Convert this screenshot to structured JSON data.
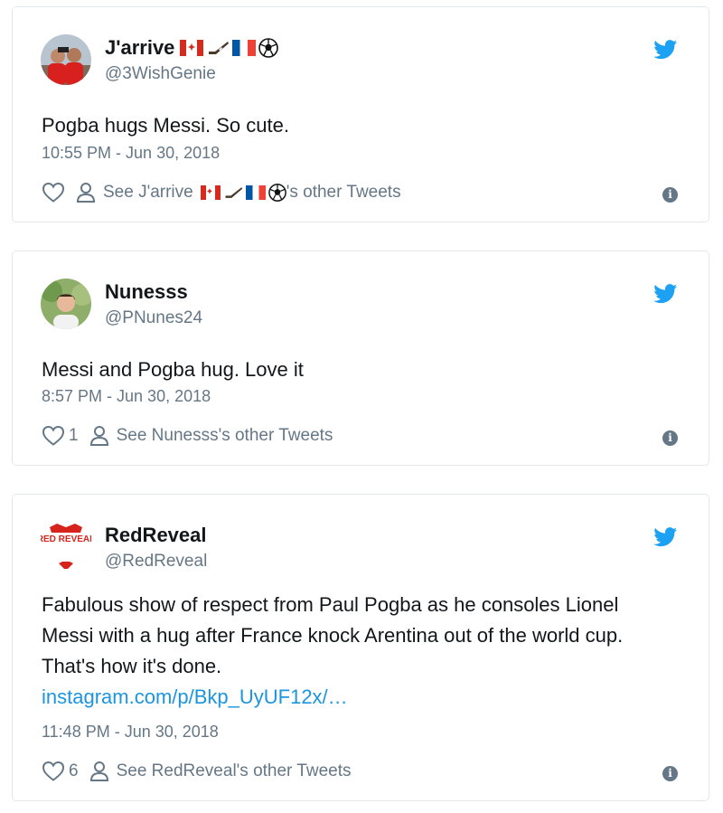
{
  "tweets": [
    {
      "display_name": "J'arrive",
      "name_emojis": [
        "flag-canada",
        "hockey-stick",
        "flag-france",
        "soccer-ball"
      ],
      "handle": "@3WishGenie",
      "text": "Pogba hugs Messi. So cute.",
      "timestamp": "10:55 PM - Jun 30, 2018",
      "likes": "",
      "other_tweets_prefix": "See J'arrive",
      "other_tweets_suffix": "'s other Tweets"
    },
    {
      "display_name": "Nunesss",
      "handle": "@PNunes24",
      "text": "Messi and Pogba hug. Love it",
      "timestamp": "8:57 PM - Jun 30, 2018",
      "likes": "1",
      "other_tweets": "See Nunesss's other Tweets"
    },
    {
      "display_name": "RedReveal",
      "handle": "@RedReveal",
      "avatar_text": "RED REVEAL",
      "text": "Fabulous show of respect from Paul Pogba as he consoles Lionel Messi with a hug after France knock Arentina out of the world cup. That's how it's done.",
      "link": "instagram.com/p/Bkp_UyUF12x/…",
      "timestamp": "11:48 PM - Jun 30, 2018",
      "likes": "6",
      "other_tweets": "See RedReveal's other Tweets"
    }
  ],
  "info_glyph": "i",
  "colors": {
    "twitter_blue": "#1da1f2",
    "link": "#1b95e0",
    "secondary_text": "#657786",
    "border": "#e1e8ed",
    "redreveal_red": "#d6231c"
  }
}
